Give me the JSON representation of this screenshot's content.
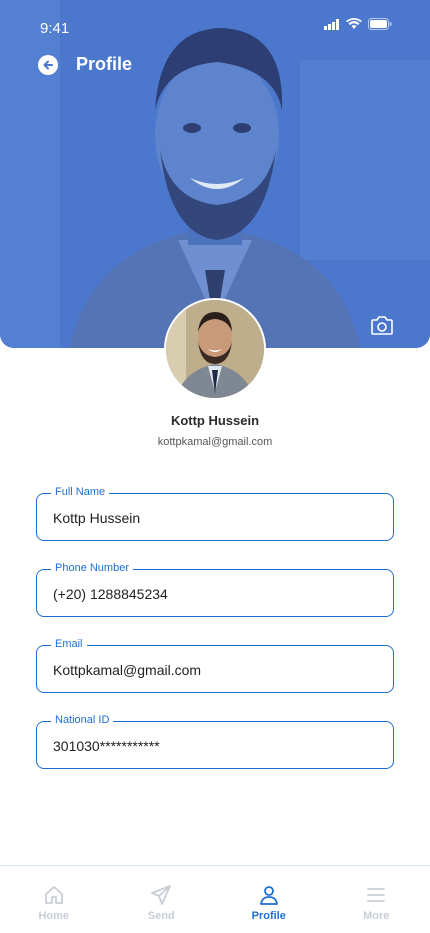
{
  "status": {
    "time": "9:41"
  },
  "header": {
    "title": "Profile"
  },
  "user": {
    "name": "Kottp Hussein",
    "email": "kottpkamal@gmail.com"
  },
  "fields": [
    {
      "label": "Full Name",
      "value": "Kottp Hussein"
    },
    {
      "label": "Phone Number",
      "value": "(+20) 1288845234"
    },
    {
      "label": "Email",
      "value": "Kottpkamal@gmail.com"
    },
    {
      "label": "National ID",
      "value": "301030***********"
    }
  ],
  "nav": [
    {
      "label": "Home",
      "icon": "home-icon",
      "active": false
    },
    {
      "label": "Send",
      "icon": "send-icon",
      "active": false
    },
    {
      "label": "Profile",
      "icon": "profile-icon",
      "active": true
    },
    {
      "label": "More",
      "icon": "menu-icon",
      "active": false
    }
  ],
  "colors": {
    "primary": "#1f6fd2",
    "header_overlay": "#4b78cc",
    "inactive": "#c9ced6"
  }
}
